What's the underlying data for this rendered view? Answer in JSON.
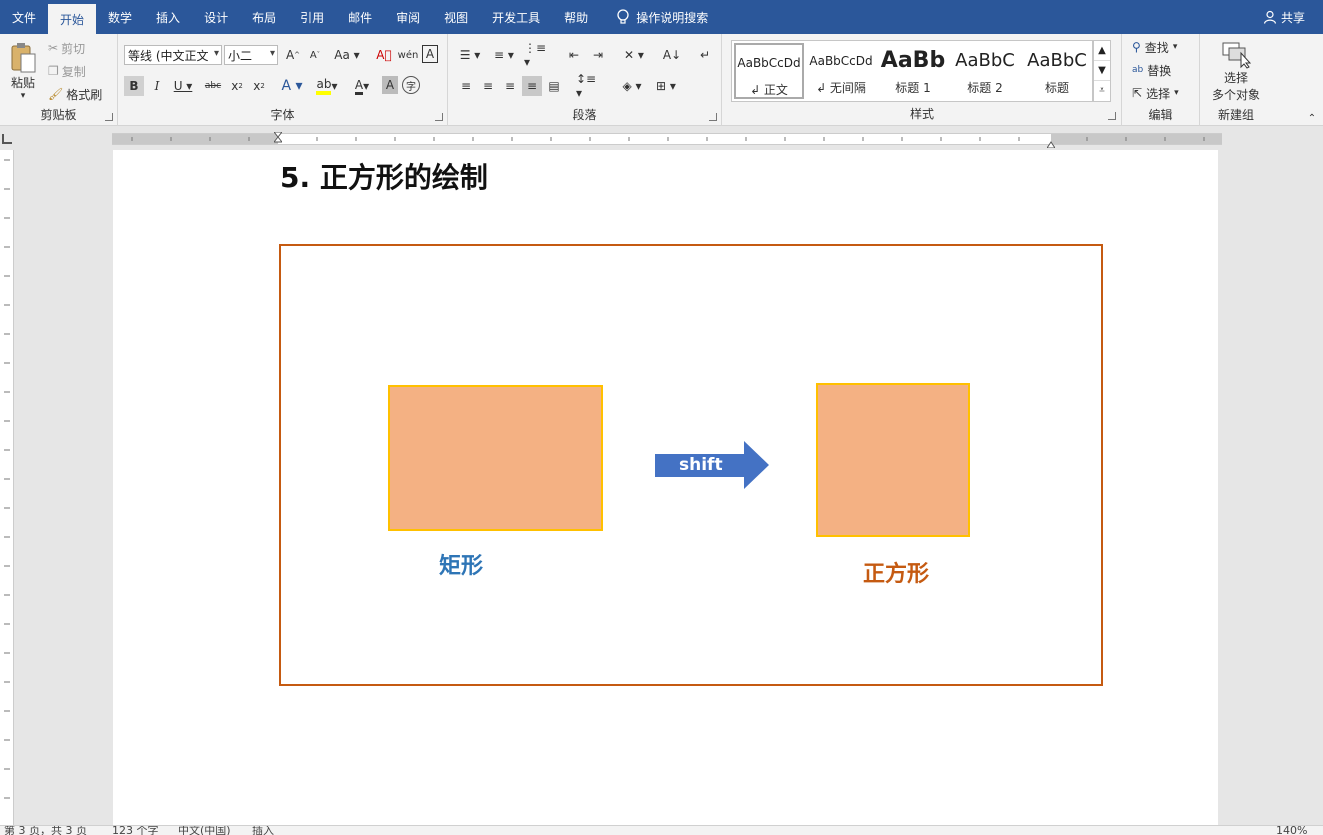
{
  "menubar": {
    "tabs": [
      "文件",
      "开始",
      "数学",
      "插入",
      "设计",
      "布局",
      "引用",
      "邮件",
      "审阅",
      "视图",
      "开发工具",
      "帮助"
    ],
    "search": "操作说明搜索",
    "share": "共享"
  },
  "ribbon": {
    "clipboard": {
      "paste": "粘贴",
      "cut": "剪切",
      "copy": "复制",
      "format_painter": "格式刷",
      "label": "剪贴板"
    },
    "font": {
      "name": "等线 (中文正文",
      "size": "小二",
      "label": "字体"
    },
    "paragraph": {
      "label": "段落"
    },
    "styles": {
      "label": "样式",
      "items": [
        {
          "sample": "AaBbCcDd",
          "name": "↲ 正文"
        },
        {
          "sample": "AaBbCcDd",
          "name": "↲ 无间隔"
        },
        {
          "sample": "AaBb",
          "name": "标题 1"
        },
        {
          "sample": "AaBbC",
          "name": "标题 2"
        },
        {
          "sample": "AaBbC",
          "name": "标题"
        }
      ]
    },
    "editing": {
      "find": "查找",
      "replace": "替换",
      "select": "选择",
      "label": "编辑"
    },
    "newgroup": {
      "select_objects_1": "选择",
      "select_objects_2": "多个对象",
      "label": "新建组"
    }
  },
  "document": {
    "heading": "5.  正方形的绘制",
    "label_rect": "矩形",
    "label_square": "正方形",
    "arrow_text": "shift"
  },
  "colors": {
    "accent": "#2b579a",
    "shape_fill": "#f4b183",
    "shape_border": "#ffc000",
    "frame": "#c55a11",
    "arrow": "#4472c4",
    "label_rect": "#2e75b6",
    "label_square": "#c55a11"
  },
  "statusbar": {
    "page": "第 3 页，共 3 页",
    "words": "123 个字",
    "lang": "中文(中国)",
    "mode": "插入",
    "zoom": "140%"
  }
}
